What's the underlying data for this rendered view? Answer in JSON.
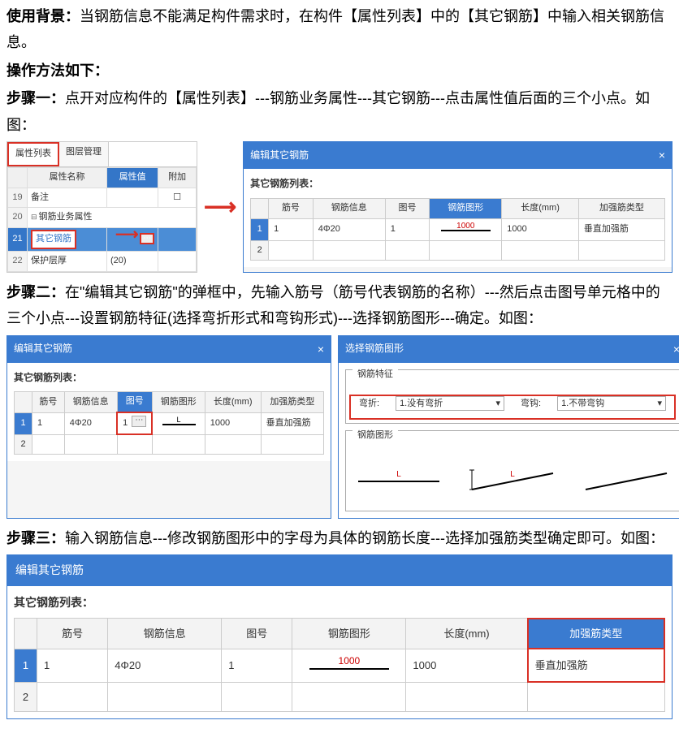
{
  "intro": {
    "label": "使用背景：",
    "text": "当钢筋信息不能满足构件需求时，在构件【属性列表】中的【其它钢筋】中输入相关钢筋信息。"
  },
  "method_heading": "操作方法如下：",
  "step1": {
    "label": "步骤一：",
    "text": "点开对应构件的【属性列表】---钢筋业务属性---其它钢筋---点击属性值后面的三个小点。如图："
  },
  "step2": {
    "label": "步骤二：",
    "text": "在\"编辑其它钢筋\"的弹框中，先输入筋号（筋号代表钢筋的名称）---然后点击图号单元格中的三个小点---设置钢筋特征(选择弯折形式和弯钩形式)---选择钢筋图形---确定。如图："
  },
  "step3": {
    "label": "步骤三：",
    "text": "输入钢筋信息---修改钢筋图形中的字母为具体的钢筋长度---选择加强筋类型确定即可。如图："
  },
  "prop_panel": {
    "tab_active": "属性列表",
    "tab_inactive": "图层管理",
    "col_name": "属性名称",
    "col_value": "属性值",
    "col_add": "附加",
    "rows": {
      "r19_num": "19",
      "r19_name": "备注",
      "r20_num": "20",
      "r20_name": "钢筋业务属性",
      "r21_num": "21",
      "r21_name": "其它钢筋",
      "r22_num": "22",
      "r22_name": "保护层厚",
      "r22_val": "(20)"
    },
    "ellipsis": "⋯"
  },
  "editor_dialog": {
    "title": "编辑其它钢筋",
    "sub": "其它钢筋列表：",
    "close": "×",
    "cols": {
      "jinhao": "筋号",
      "ganjin": "钢筋信息",
      "tuhao": "图号",
      "shape": "钢筋图形",
      "length": "长度(mm)",
      "type": "加强筋类型"
    },
    "row1": {
      "num": "1",
      "jinhao": "1",
      "ganjin": "4Φ20",
      "tuhao": "1",
      "shape_label": "1000",
      "length": "1000",
      "type": "垂直加强筋"
    },
    "row2_num": "2"
  },
  "select_shape": {
    "title": "选择钢筋图形",
    "feature_group": "钢筋特征",
    "bend_label": "弯折:",
    "bend_value": "1.没有弯折",
    "hook_label": "弯钩:",
    "hook_value": "1.不带弯钩",
    "shape_group": "钢筋图形",
    "shape_l": "L"
  }
}
